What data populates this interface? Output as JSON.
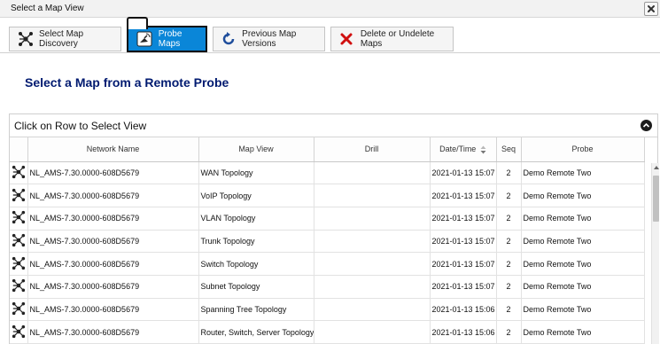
{
  "window": {
    "title": "Select a Map View"
  },
  "tabs": [
    {
      "label": "Select Map Discovery",
      "icon": "network-icon"
    },
    {
      "label": "Probe Maps",
      "icon": "probe-icon"
    },
    {
      "label": "Previous Map Versions",
      "icon": "refresh-icon"
    },
    {
      "label": "Delete or Undelete Maps",
      "icon": "delete-icon"
    }
  ],
  "heading": "Select a Map from a Remote Probe",
  "panel": {
    "title": "Click on Row to Select View"
  },
  "table": {
    "columns": [
      "",
      "Network Name",
      "Map View",
      "Drill",
      "Date/Time",
      "Seq",
      "Probe"
    ],
    "rows": [
      [
        "NL_AMS-7.30.0000-608D5679",
        "WAN Topology",
        "",
        "2021-01-13 15:07",
        "2",
        "Demo Remote Two"
      ],
      [
        "NL_AMS-7.30.0000-608D5679",
        "VoIP Topology",
        "",
        "2021-01-13 15:07",
        "2",
        "Demo Remote Two"
      ],
      [
        "NL_AMS-7.30.0000-608D5679",
        "VLAN Topology",
        "",
        "2021-01-13 15:07",
        "2",
        "Demo Remote Two"
      ],
      [
        "NL_AMS-7.30.0000-608D5679",
        "Trunk Topology",
        "",
        "2021-01-13 15:07",
        "2",
        "Demo Remote Two"
      ],
      [
        "NL_AMS-7.30.0000-608D5679",
        "Switch Topology",
        "",
        "2021-01-13 15:07",
        "2",
        "Demo Remote Two"
      ],
      [
        "NL_AMS-7.30.0000-608D5679",
        "Subnet Topology",
        "",
        "2021-01-13 15:07",
        "2",
        "Demo Remote Two"
      ],
      [
        "NL_AMS-7.30.0000-608D5679",
        "Spanning Tree Topology",
        "",
        "2021-01-13 15:06",
        "2",
        "Demo Remote Two"
      ],
      [
        "NL_AMS-7.30.0000-608D5679",
        "Router, Switch, Server Topology",
        "",
        "2021-01-13 15:06",
        "2",
        "Demo Remote Two"
      ]
    ]
  },
  "colors": {
    "active_tab": "#0a86d8",
    "heading": "#001a70"
  }
}
